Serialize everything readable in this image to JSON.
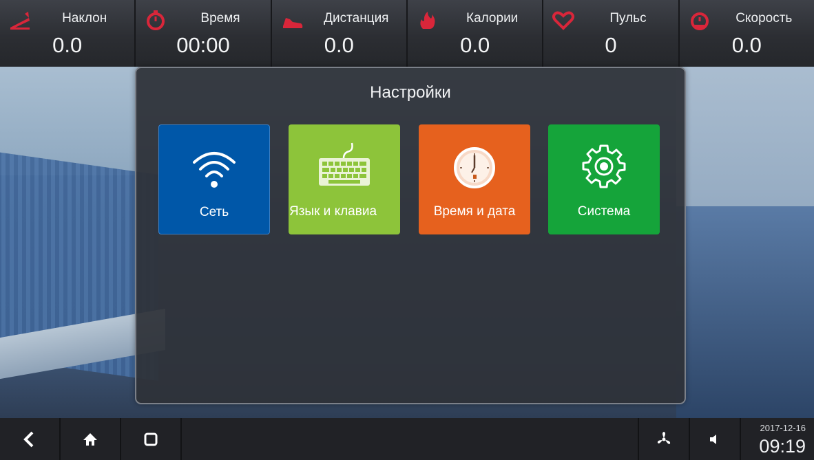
{
  "stats": [
    {
      "id": "incline",
      "label": "Наклон",
      "value": "0.0",
      "icon": "incline-icon",
      "color": "#d9263a"
    },
    {
      "id": "time",
      "label": "Время",
      "value": "00:00",
      "icon": "stopwatch-icon",
      "color": "#d9263a"
    },
    {
      "id": "distance",
      "label": "Дистанция",
      "value": "0.0",
      "icon": "shoe-icon",
      "color": "#d9263a"
    },
    {
      "id": "calories",
      "label": "Калории",
      "value": "0.0",
      "icon": "flame-icon",
      "color": "#d9263a"
    },
    {
      "id": "pulse",
      "label": "Пульс",
      "value": "0",
      "icon": "heart-icon",
      "color": "#d9263a"
    },
    {
      "id": "speed",
      "label": "Скорость",
      "value": "0.0",
      "icon": "speedometer-icon",
      "color": "#d9263a"
    }
  ],
  "dialog": {
    "title": "Настройки",
    "tiles": [
      {
        "label": "Сеть",
        "icon": "wifi-icon",
        "color": "#0057a8"
      },
      {
        "label": "Язык и клавиа",
        "icon": "keyboard-icon",
        "color": "#8dc43a"
      },
      {
        "label": "Время и дата",
        "icon": "clock-icon",
        "color": "#e6611e"
      },
      {
        "label": "Система",
        "icon": "gear-icon",
        "color": "#15a43a"
      }
    ]
  },
  "navbar": {
    "buttons": [
      "back-icon",
      "home-icon",
      "recent-apps-icon"
    ],
    "right_buttons": [
      "fan-icon",
      "volume-icon"
    ],
    "date": "2017-12-16",
    "time": "09:19"
  }
}
